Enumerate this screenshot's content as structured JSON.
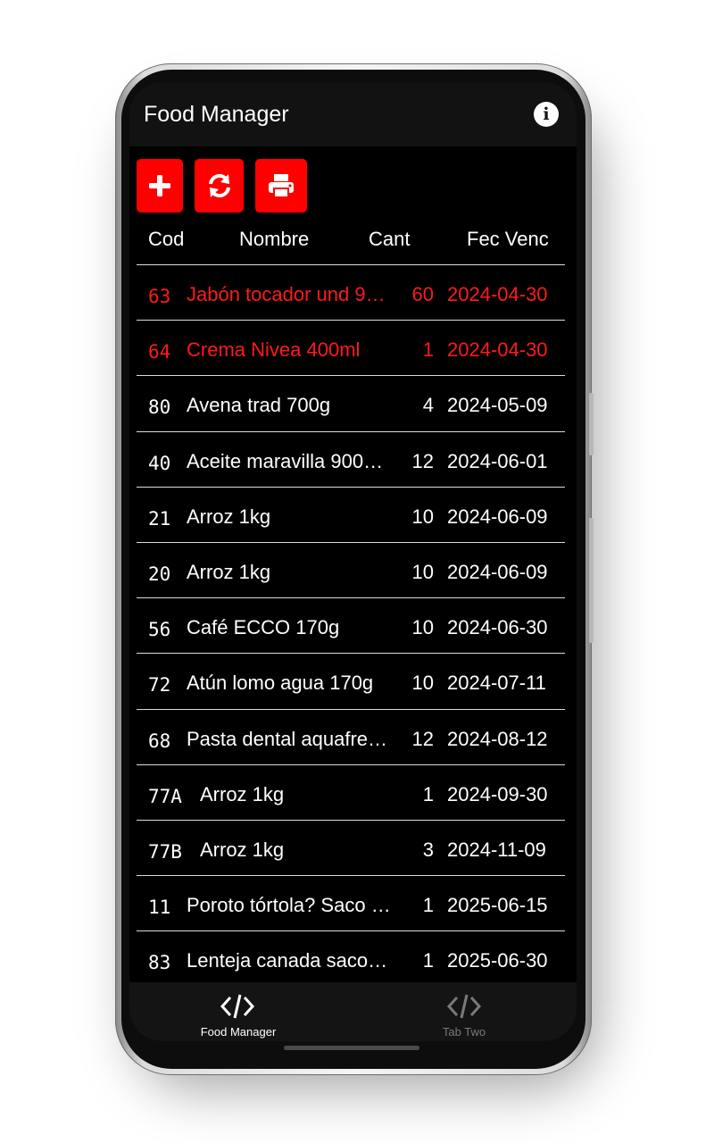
{
  "app": {
    "title": "Food Manager"
  },
  "header_icons": {
    "info": "info-icon"
  },
  "toolbar": {
    "buttons": [
      {
        "name": "add-button",
        "icon": "plus-icon"
      },
      {
        "name": "refresh-button",
        "icon": "sync-icon"
      },
      {
        "name": "print-button",
        "icon": "print-icon"
      }
    ],
    "accent_color": "#ff0000"
  },
  "table": {
    "columns": [
      "Cod",
      "Nombre",
      "Cant",
      "Fec Venc"
    ],
    "rows": [
      {
        "code": "63",
        "name": "Jabón tocador und 9…",
        "qty": "60",
        "date": "2024-04-30",
        "expired": true
      },
      {
        "code": "64",
        "name": "Crema Nivea 400ml",
        "qty": "1",
        "date": "2024-04-30",
        "expired": true
      },
      {
        "code": "80",
        "name": "Avena trad 700g",
        "qty": "4",
        "date": "2024-05-09",
        "expired": false
      },
      {
        "code": "40",
        "name": "Aceite maravilla 900…",
        "qty": "12",
        "date": "2024-06-01",
        "expired": false
      },
      {
        "code": "21",
        "name": "Arroz 1kg",
        "qty": "10",
        "date": "2024-06-09",
        "expired": false
      },
      {
        "code": "20",
        "name": "Arroz 1kg",
        "qty": "10",
        "date": "2024-06-09",
        "expired": false
      },
      {
        "code": "56",
        "name": "Café ECCO 170g",
        "qty": "10",
        "date": "2024-06-30",
        "expired": false
      },
      {
        "code": "72",
        "name": "Atún lomo agua 170g",
        "qty": "10",
        "date": "2024-07-11",
        "expired": false
      },
      {
        "code": "68",
        "name": "Pasta dental aquafre…",
        "qty": "12",
        "date": "2024-08-12",
        "expired": false
      },
      {
        "code": "77A",
        "name": "Arroz 1kg",
        "qty": "1",
        "date": "2024-09-30",
        "expired": false
      },
      {
        "code": "77B",
        "name": "Arroz 1kg",
        "qty": "3",
        "date": "2024-11-09",
        "expired": false
      },
      {
        "code": "11",
        "name": "Poroto tórtola? Saco 2…",
        "qty": "1",
        "date": "2025-06-15",
        "expired": false
      },
      {
        "code": "83",
        "name": "Lenteja canada saco …",
        "qty": "1",
        "date": "2025-06-30",
        "expired": false
      }
    ],
    "expired_color": "#ff1a1a"
  },
  "bottom_nav": {
    "tabs": [
      {
        "label": "Food Manager",
        "icon": "code-icon",
        "active": true
      },
      {
        "label": "Tab Two",
        "icon": "code-icon",
        "active": false
      }
    ]
  }
}
